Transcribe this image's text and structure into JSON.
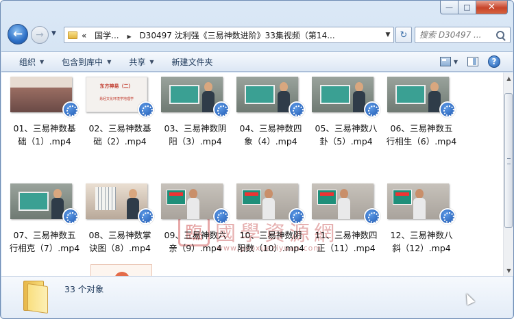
{
  "window": {
    "caption": {
      "minimize": "—",
      "maximize": "□",
      "close": "✕"
    }
  },
  "nav": {
    "address_parts": [
      "«",
      "国学...",
      "D30497 沈利强《三易神数进阶》33集视频（第14..."
    ],
    "search_placeholder": "搜索 D30497 ..."
  },
  "toolbar": {
    "organize": "组织",
    "include_in_library": "包含到库中",
    "share": "共享",
    "new_folder": "新建文件夹"
  },
  "files": [
    {
      "line1": "01、三易神数基",
      "line2": "础（1）.mp4",
      "thumb": "hall"
    },
    {
      "line1": "02、三易神数基",
      "line2": "础（2）.mp4",
      "thumb": "title",
      "t1": "东方神易（二）",
      "t2": "易经文化环境学地理学"
    },
    {
      "line1": "03、三易神数阴",
      "line2": "阳（3）.mp4",
      "thumb": "wall"
    },
    {
      "line1": "04、三易神数四",
      "line2": "象（4）.mp4",
      "thumb": "wall"
    },
    {
      "line1": "05、三易神数八",
      "line2": "卦（5）.mp4",
      "thumb": "wall"
    },
    {
      "line1": "06、三易神数五",
      "line2": "行相生（6）.mp4",
      "thumb": "wall"
    },
    {
      "line1": "07、三易神数五",
      "line2": "行相克（7）.mp4",
      "thumb": "wall"
    },
    {
      "line1": "08、三易神数掌",
      "line2": "诀图（8）.mp4",
      "thumb": "room"
    },
    {
      "line1": "09、三易神数六",
      "line2": "亲（9）.mp4",
      "thumb": "studio"
    },
    {
      "line1": "10、三易神数阴",
      "line2": "阳数（10）.mp4",
      "thumb": "studio"
    },
    {
      "line1": "11、三易神数四",
      "line2": "正（11）.mp4",
      "thumb": "studio"
    },
    {
      "line1": "12、三易神数八",
      "line2": "斜（12）.mp4",
      "thumb": "studio"
    }
  ],
  "watermark": {
    "seal": "臨",
    "text": "國學資源網",
    "url": "www.guoxueziyuan.com"
  },
  "status": {
    "count": "33 个对象"
  },
  "colors": {
    "accent": "#1e395b",
    "play_badge": "#1d57b0",
    "watermark": "#e6b0b0"
  }
}
